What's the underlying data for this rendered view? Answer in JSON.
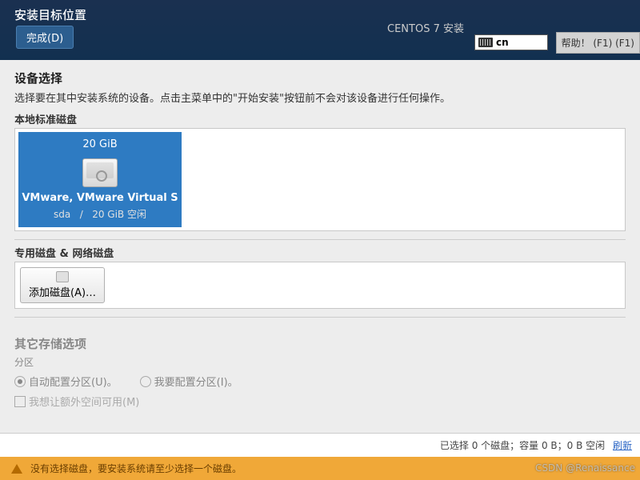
{
  "header": {
    "title": "安装目标位置",
    "done_label": "完成(D)",
    "product": "CENTOS 7 安装",
    "keyboard": "cn",
    "help_label": "帮助！ (F1) (F1)"
  },
  "device_selection": {
    "title": "设备选择",
    "helper": "选择要在其中安装系统的设备。点击主菜单中的\"开始安装\"按钮前不会对该设备进行任何操作。",
    "local_label": "本地标准磁盘",
    "disk": {
      "size": "20 GiB",
      "name": "VMware, VMware Virtual S",
      "dev": "sda",
      "sep": "/",
      "free": "20 GiB 空闲"
    },
    "special_label": "专用磁盘 & 网络磁盘",
    "add_disk_label": "添加磁盘(A)…"
  },
  "other_storage": {
    "title": "其它存储选项",
    "partition_label": "分区",
    "auto_label": "自动配置分区(U)。",
    "manual_label": "我要配置分区(I)。",
    "extra_label": "我想让额外空间可用(M)"
  },
  "status": {
    "summary": "已选择 0 个磁盘；容量 0 B；0 B 空闲",
    "refresh": "刷新"
  },
  "warning": {
    "text": "没有选择磁盘，要安装系统请至少选择一个磁盘。"
  },
  "watermark": "CSDN @Renaissance"
}
